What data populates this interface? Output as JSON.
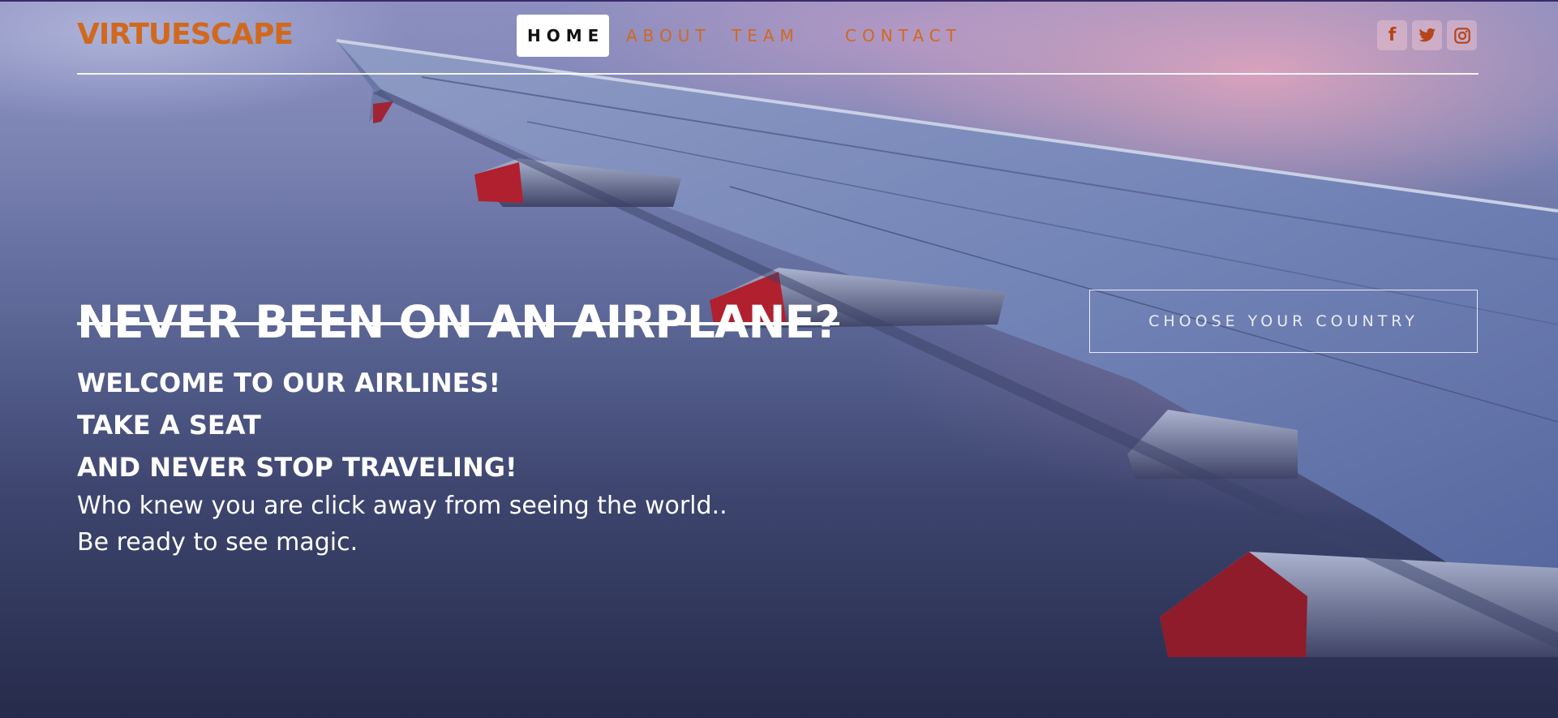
{
  "header": {
    "brand": "VIRTUESCAPE",
    "nav": [
      {
        "label": "HOME",
        "active": true
      },
      {
        "label": "ABOUT"
      },
      {
        "label": "TEAM"
      },
      {
        "label": "CONTACT"
      }
    ],
    "social": [
      {
        "icon": "facebook-icon",
        "glyph": "f"
      },
      {
        "icon": "twitter-icon"
      },
      {
        "icon": "instagram-icon"
      }
    ]
  },
  "hero": {
    "headline": "NEVER BEEN ON AN AIRPLANE?",
    "lines": [
      "WELCOME TO OUR AIRLINES!",
      "TAKE A SEAT",
      "AND NEVER STOP TRAVELING!"
    ],
    "body": [
      "Who knew you are click away from seeing the world..",
      "Be ready to see magic."
    ],
    "cta": "CHOOSE YOUR COUNTRY"
  },
  "colors": {
    "brand": "#d0691e",
    "icon": "#b5451b",
    "text": "#ffffff"
  }
}
